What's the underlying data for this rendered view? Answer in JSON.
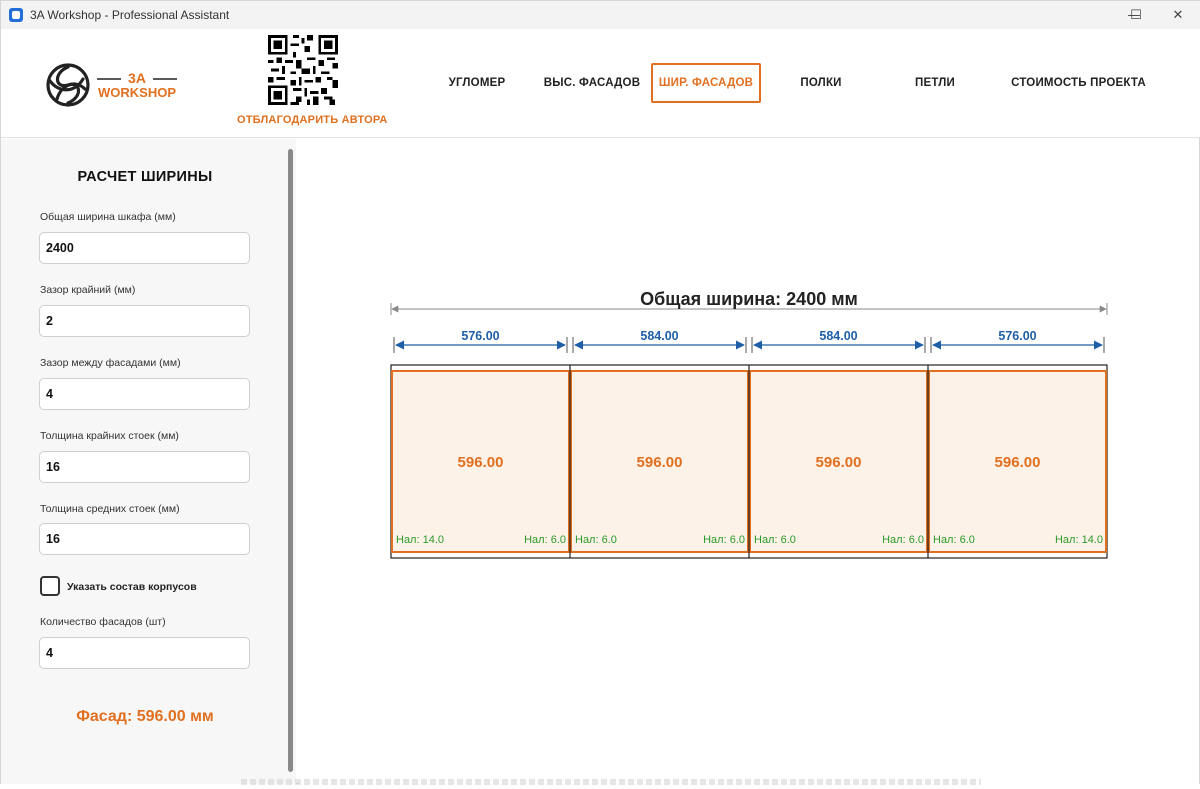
{
  "window": {
    "title": "3A Workshop - Professional Assistant",
    "controls": {
      "minimize": "—",
      "maximize": "☐",
      "close": "✕"
    }
  },
  "header": {
    "logo": {
      "top": "3A",
      "bottom": "WORKSHOP"
    },
    "thank_link": "ОТБЛАГОДАРИТЬ АВТОРА",
    "nav": [
      {
        "label": "УГЛОМЕР"
      },
      {
        "label": "ВЫС. ФАСАДОВ"
      },
      {
        "label": "ШИР. ФАСАДОВ",
        "active": true
      },
      {
        "label": "ПОЛКИ"
      },
      {
        "label": "ПЕТЛИ"
      },
      {
        "label": "СТОИМОСТЬ ПРОЕКТА"
      }
    ]
  },
  "sidebar": {
    "title": "РАСЧЕТ ШИРИНЫ",
    "fields": [
      {
        "label": "Общая ширина шкафа (мм)",
        "value": "2400"
      },
      {
        "label": "Зазор крайний (мм)",
        "value": "2"
      },
      {
        "label": "Зазор между фасадами (мм)",
        "value": "4"
      },
      {
        "label": "Толщина крайних стоек (мм)",
        "value": "16"
      },
      {
        "label": "Толщина средних стоек (мм)",
        "value": "16"
      }
    ],
    "checkbox": {
      "label": "Указать состав корпусов",
      "checked": false
    },
    "count_field": {
      "label": "Количество фасадов (шт)",
      "value": "4"
    },
    "result": "Фасад: 596.00 мм"
  },
  "drawing": {
    "total_label": "Общая ширина: 2400 мм",
    "facades": [
      {
        "width_label": "576.00",
        "height_label": "596.00",
        "left_overlay": "Нал: 14.0",
        "right_overlay": "Нал: 6.0"
      },
      {
        "width_label": "584.00",
        "height_label": "596.00",
        "left_overlay": "Нал: 6.0",
        "right_overlay": "Нал: 6.0"
      },
      {
        "width_label": "584.00",
        "height_label": "596.00",
        "left_overlay": "Нал: 6.0",
        "right_overlay": "Нал: 6.0"
      },
      {
        "width_label": "576.00",
        "height_label": "596.00",
        "left_overlay": "Нал: 6.0",
        "right_overlay": "Нал: 14.0"
      }
    ],
    "colors": {
      "accent": "#e07020",
      "dimension": "#1f5fa8",
      "facade_fill": "#fdf2e7",
      "overlay_text": "#2a9a2a",
      "outline": "#222222"
    }
  }
}
